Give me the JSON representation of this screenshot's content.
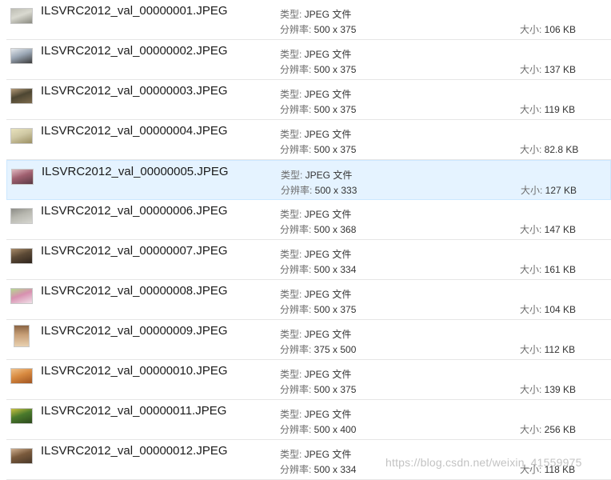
{
  "labels": {
    "type": "类型: ",
    "resolution": "分辨率: ",
    "size": "大小: "
  },
  "selected_index": 4,
  "files": [
    {
      "name": "ILSVRC2012_val_00000001.JPEG",
      "type": "JPEG 文件",
      "resolution": "500 x 375",
      "size": "106 KB",
      "thumb_colors": [
        "#d9d9d0",
        "#bdbdb3",
        "#8a8a80"
      ]
    },
    {
      "name": "ILSVRC2012_val_00000002.JPEG",
      "type": "JPEG 文件",
      "resolution": "500 x 375",
      "size": "137 KB",
      "thumb_colors": [
        "#9aa6b4",
        "#e4e8ec",
        "#3b3b3b"
      ]
    },
    {
      "name": "ILSVRC2012_val_00000003.JPEG",
      "type": "JPEG 文件",
      "resolution": "500 x 375",
      "size": "119 KB",
      "thumb_colors": [
        "#4d4632",
        "#b49a78",
        "#7c6a4c"
      ]
    },
    {
      "name": "ILSVRC2012_val_00000004.JPEG",
      "type": "JPEG 文件",
      "resolution": "500 x 375",
      "size": "82.8 KB",
      "thumb_colors": [
        "#cfc8a4",
        "#e8e2bc",
        "#9b8f62"
      ]
    },
    {
      "name": "ILSVRC2012_val_00000005.JPEG",
      "type": "JPEG 文件",
      "resolution": "500 x 333",
      "size": "127 KB",
      "thumb_colors": [
        "#a06070",
        "#e0b8c0",
        "#5a3a44"
      ]
    },
    {
      "name": "ILSVRC2012_val_00000006.JPEG",
      "type": "JPEG 文件",
      "resolution": "500 x 368",
      "size": "147 KB",
      "thumb_colors": [
        "#b8b8b0",
        "#8c8c86",
        "#d6d6d0"
      ]
    },
    {
      "name": "ILSVRC2012_val_00000007.JPEG",
      "type": "JPEG 文件",
      "resolution": "500 x 334",
      "size": "161 KB",
      "thumb_colors": [
        "#5c4a36",
        "#a88a68",
        "#2e241c"
      ]
    },
    {
      "name": "ILSVRC2012_val_00000008.JPEG",
      "type": "JPEG 文件",
      "resolution": "500 x 375",
      "size": "104 KB",
      "thumb_colors": [
        "#d890b0",
        "#b4d890",
        "#f0e0e8"
      ]
    },
    {
      "name": "ILSVRC2012_val_00000009.JPEG",
      "type": "JPEG 文件",
      "resolution": "375 x 500",
      "size": "112 KB",
      "thumb_colors": [
        "#c8a078",
        "#8a6444",
        "#e8d0b0"
      ],
      "tall": true
    },
    {
      "name": "ILSVRC2012_val_00000010.JPEG",
      "type": "JPEG 文件",
      "resolution": "500 x 375",
      "size": "139 KB",
      "thumb_colors": [
        "#d88a40",
        "#f0c088",
        "#a05420"
      ]
    },
    {
      "name": "ILSVRC2012_val_00000011.JPEG",
      "type": "JPEG 文件",
      "resolution": "500 x 400",
      "size": "256 KB",
      "thumb_colors": [
        "#4a7a2c",
        "#c8c040",
        "#2c4a1c"
      ]
    },
    {
      "name": "ILSVRC2012_val_00000012.JPEG",
      "type": "JPEG 文件",
      "resolution": "500 x 334",
      "size": "118 KB",
      "thumb_colors": [
        "#7a5a3c",
        "#d0b090",
        "#4a3828"
      ]
    }
  ],
  "watermark": "https://blog.csdn.net/weixin_41559975"
}
